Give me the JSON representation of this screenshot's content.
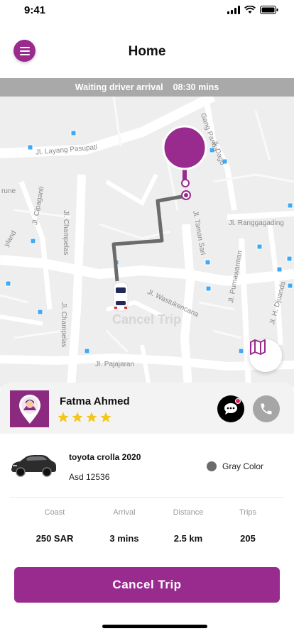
{
  "status_bar": {
    "time": "9:41"
  },
  "header": {
    "title": "Home"
  },
  "wait_bar": {
    "status": "Waiting driver arrival",
    "eta": "08:30 mins"
  },
  "map": {
    "streets": [
      "Jl. Layang Pasupati",
      "Jl. Champelas",
      "Jl. Champelas",
      "Jl. Wastukencana",
      "Jl. Pajajaran",
      "Jl. Ranggagading",
      "Jl. Taman Sari",
      "Jl. Purnawarman",
      "Jl. H. Djuanda",
      "Jl. Cipaganti",
      "Gang Panda",
      "Jl. Dago",
      "rune",
      "yland"
    ],
    "ghost_text": "Cancel Trip"
  },
  "driver": {
    "name": "Fatma Ahmed",
    "rating": 4
  },
  "car": {
    "model": "toyota crolla 2020",
    "plate": "Asd 12536",
    "color_label": "Gray Color"
  },
  "stats": [
    {
      "label": "Coast",
      "value": "250 SAR"
    },
    {
      "label": "Arrival",
      "value": "3 mins"
    },
    {
      "label": "Distance",
      "value": "2.5 km"
    },
    {
      "label": "Trips",
      "value": "205"
    }
  ],
  "actions": {
    "cancel_label": "Cancel  Trip"
  },
  "colors": {
    "brand": "#9a2b8e",
    "route": "#6b6b6b",
    "wait_bar": "#a9a9a9"
  },
  "icons": {
    "menu": "hamburger-icon",
    "chat": "chat-bubble-icon",
    "call": "phone-icon",
    "map_toggle": "map-icon",
    "signal": "signal-icon",
    "wifi": "wifi-icon",
    "battery": "battery-icon"
  }
}
